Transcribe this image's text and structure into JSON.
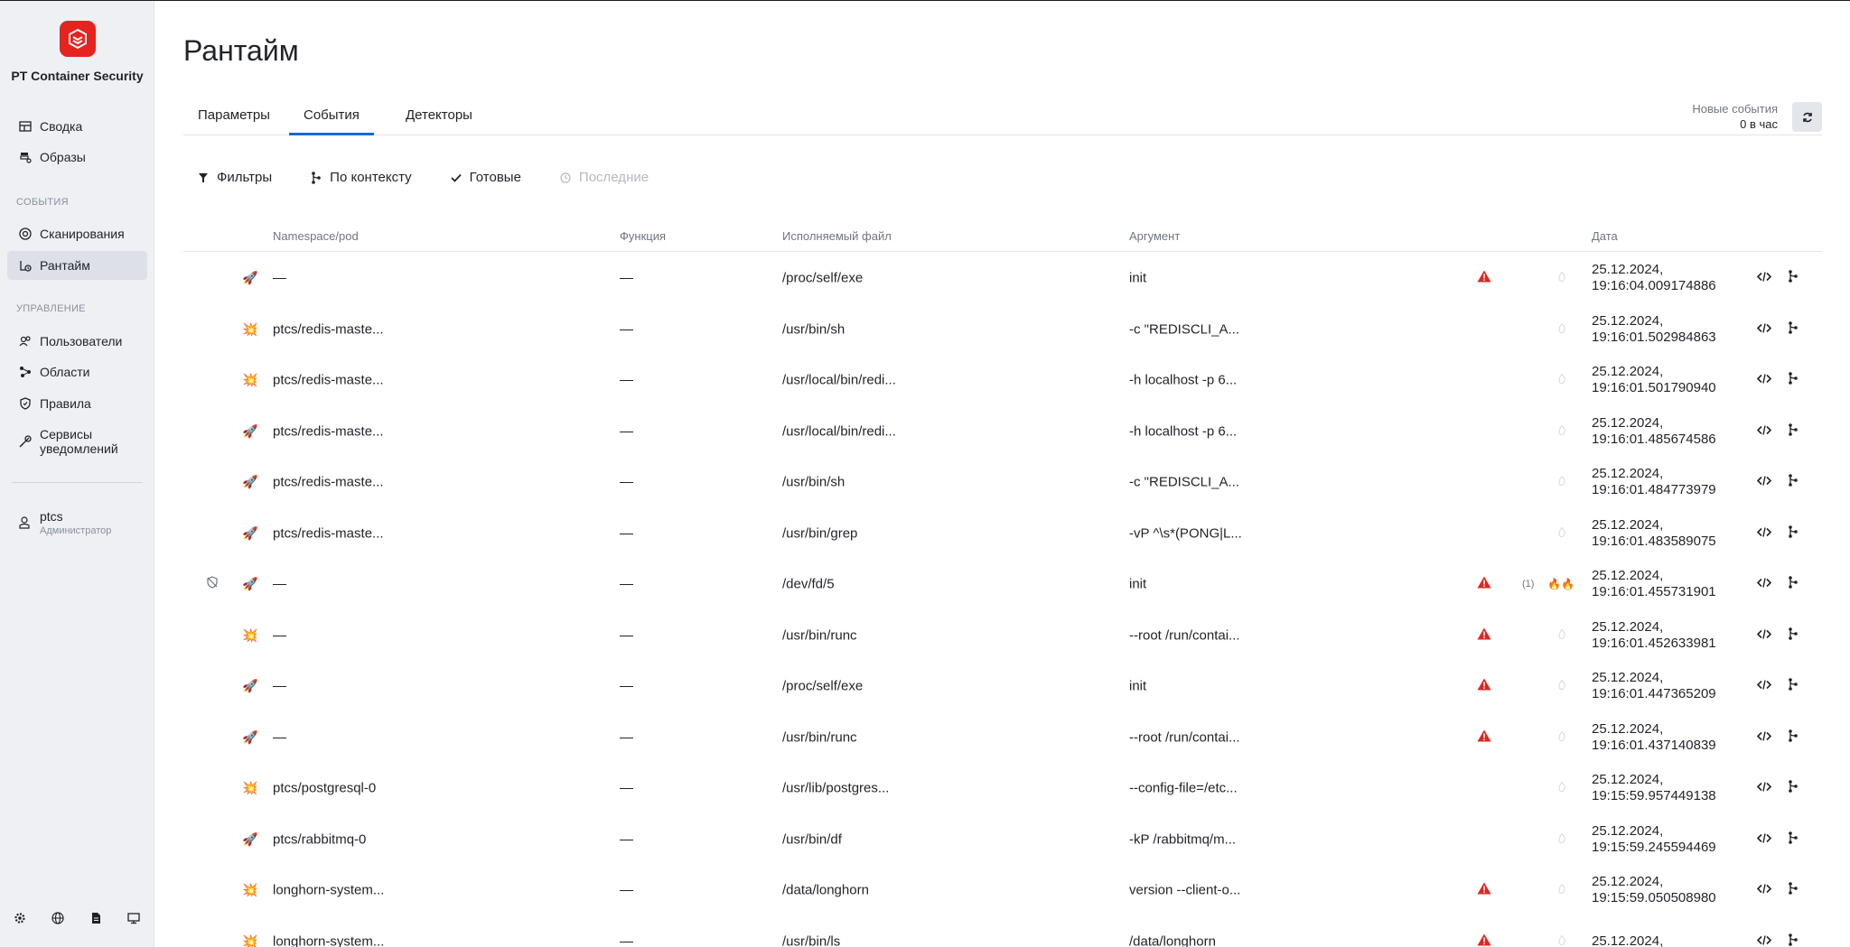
{
  "brand": "PT Container Security",
  "colors": {
    "accent": "#1769d8",
    "brand": "#e52420",
    "alert": "#e52420"
  },
  "sidebar": {
    "items_top": [
      {
        "label": "Сводка",
        "icon": "dashboard-icon"
      },
      {
        "label": "Образы",
        "icon": "images-icon"
      }
    ],
    "section_events": "СОБЫТИЯ",
    "items_events": [
      {
        "label": "Сканирования",
        "icon": "scan-icon"
      },
      {
        "label": "Рантайм",
        "icon": "runtime-icon",
        "active": true
      }
    ],
    "section_manage": "УПРАВЛЕНИЕ",
    "items_manage": [
      {
        "label": "Пользователи",
        "icon": "users-icon"
      },
      {
        "label": "Области",
        "icon": "areas-icon"
      },
      {
        "label": "Правила",
        "icon": "shield-icon"
      },
      {
        "label_line1": "Сервисы",
        "label_line2": "уведомлений",
        "icon": "notification-services-icon"
      }
    ],
    "user": {
      "name": "ptcs",
      "role": "Администратор"
    },
    "bottom_icons": [
      "gear-icon",
      "globe-icon",
      "document-icon",
      "monitor-icon"
    ]
  },
  "page": {
    "title": "Рантайм"
  },
  "tabs": [
    {
      "label": "Параметры"
    },
    {
      "label": "События",
      "active": true
    },
    {
      "label": "Детекторы"
    }
  ],
  "new_events": {
    "label": "Новые события",
    "value": "0 в час"
  },
  "toolbar": {
    "filters": "Фильтры",
    "by_context": "По контексту",
    "done": "Готовые",
    "latest": "Последние"
  },
  "table": {
    "columns": {
      "namespace": "Namespace/pod",
      "function": "Функция",
      "executable": "Исполняемый файл",
      "argument": "Аргумент",
      "date": "Дата"
    },
    "rows": [
      {
        "type": "rocket",
        "namespace": "—",
        "function": "—",
        "executable": "/proc/self/exe",
        "argument": "init",
        "alert": true,
        "date1": "25.12.2024,",
        "date2": "19:16:04.009174886"
      },
      {
        "type": "explosion",
        "namespace": "ptcs/redis-maste...",
        "function": "—",
        "executable": "/usr/bin/sh",
        "argument": "-c \"REDISCLI_A...",
        "alert": false,
        "date1": "25.12.2024,",
        "date2": "19:16:01.502984863"
      },
      {
        "type": "explosion",
        "namespace": "ptcs/redis-maste...",
        "function": "—",
        "executable": "/usr/local/bin/redi...",
        "argument": "-h localhost -p 6...",
        "alert": false,
        "date1": "25.12.2024,",
        "date2": "19:16:01.501790940"
      },
      {
        "type": "rocket",
        "namespace": "ptcs/redis-maste...",
        "function": "—",
        "executable": "/usr/local/bin/redi...",
        "argument": "-h localhost -p 6...",
        "alert": false,
        "date1": "25.12.2024,",
        "date2": "19:16:01.485674586"
      },
      {
        "type": "rocket",
        "namespace": "ptcs/redis-maste...",
        "function": "—",
        "executable": "/usr/bin/sh",
        "argument": "-c \"REDISCLI_A...",
        "alert": false,
        "date1": "25.12.2024,",
        "date2": "19:16:01.484773979"
      },
      {
        "type": "rocket",
        "namespace": "ptcs/redis-maste...",
        "function": "—",
        "executable": "/usr/bin/grep",
        "argument": "-vP ^\\s*(PONG|L...",
        "alert": false,
        "date1": "25.12.2024,",
        "date2": "19:16:01.483589075"
      },
      {
        "type": "rocket",
        "namespace": "—",
        "function": "—",
        "executable": "/dev/fd/5",
        "argument": "init",
        "alert": true,
        "count": "(1)",
        "fire": true,
        "shield_off": true,
        "date1": "25.12.2024,",
        "date2": "19:16:01.455731901"
      },
      {
        "type": "explosion",
        "namespace": "—",
        "function": "—",
        "executable": "/usr/bin/runc",
        "argument": "--root /run/contai...",
        "alert": true,
        "date1": "25.12.2024,",
        "date2": "19:16:01.452633981"
      },
      {
        "type": "rocket",
        "namespace": "—",
        "function": "—",
        "executable": "/proc/self/exe",
        "argument": "init",
        "alert": true,
        "date1": "25.12.2024,",
        "date2": "19:16:01.447365209"
      },
      {
        "type": "rocket",
        "namespace": "—",
        "function": "—",
        "executable": "/usr/bin/runc",
        "argument": "--root /run/contai...",
        "alert": true,
        "date1": "25.12.2024,",
        "date2": "19:16:01.437140839"
      },
      {
        "type": "explosion",
        "namespace": "ptcs/postgresql-0",
        "function": "—",
        "executable": "/usr/lib/postgres...",
        "argument": "--config-file=/etc...",
        "alert": false,
        "date1": "25.12.2024,",
        "date2": "19:15:59.957449138"
      },
      {
        "type": "rocket",
        "namespace": "ptcs/rabbitmq-0",
        "function": "—",
        "executable": "/usr/bin/df",
        "argument": "-kP /rabbitmq/m...",
        "alert": false,
        "date1": "25.12.2024,",
        "date2": "19:15:59.245594469"
      },
      {
        "type": "explosion",
        "namespace": "longhorn-system...",
        "function": "—",
        "executable": "/data/longhorn",
        "argument": "version --client-o...",
        "alert": true,
        "date1": "25.12.2024,",
        "date2": "19:15:59.050508980"
      },
      {
        "type": "explosion",
        "namespace": "longhorn-system...",
        "function": "—",
        "executable": "/usr/bin/ls",
        "argument": "/data/longhorn",
        "alert": true,
        "date1": "25.12.2024,",
        "date2": ""
      }
    ]
  }
}
